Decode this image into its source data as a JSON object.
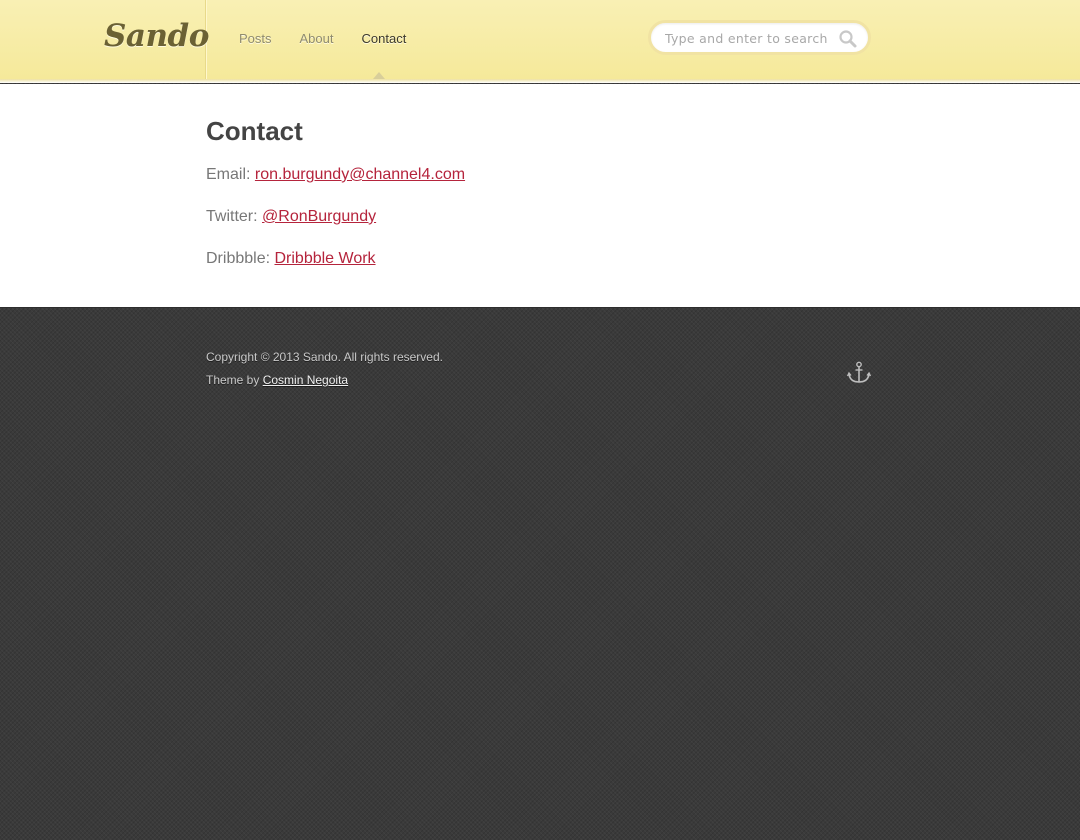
{
  "header": {
    "logo": "Sando",
    "nav": [
      {
        "label": "Posts"
      },
      {
        "label": "About"
      },
      {
        "label": "Contact",
        "active": true
      }
    ],
    "search": {
      "placeholder": "Type and enter to search",
      "icon": "search-icon"
    }
  },
  "main": {
    "title": "Contact",
    "rows": [
      {
        "label": "Email:",
        "link": "ron.burgundy@channel4.com"
      },
      {
        "label": "Twitter:",
        "link": "@RonBurgundy"
      },
      {
        "label": "Dribbble:",
        "link": "Dribbble Work"
      }
    ]
  },
  "footer": {
    "copyright": "Copyright © 2013 Sando. All rights reserved.",
    "theme_prefix": "Theme by",
    "theme_author": "Cosmin Negoita",
    "back_to_top_icon": "anchor-icon"
  },
  "colors": {
    "header_bg": "#f6ec9f",
    "link": "#b5243c",
    "footer_bg": "#3a3a3a"
  }
}
